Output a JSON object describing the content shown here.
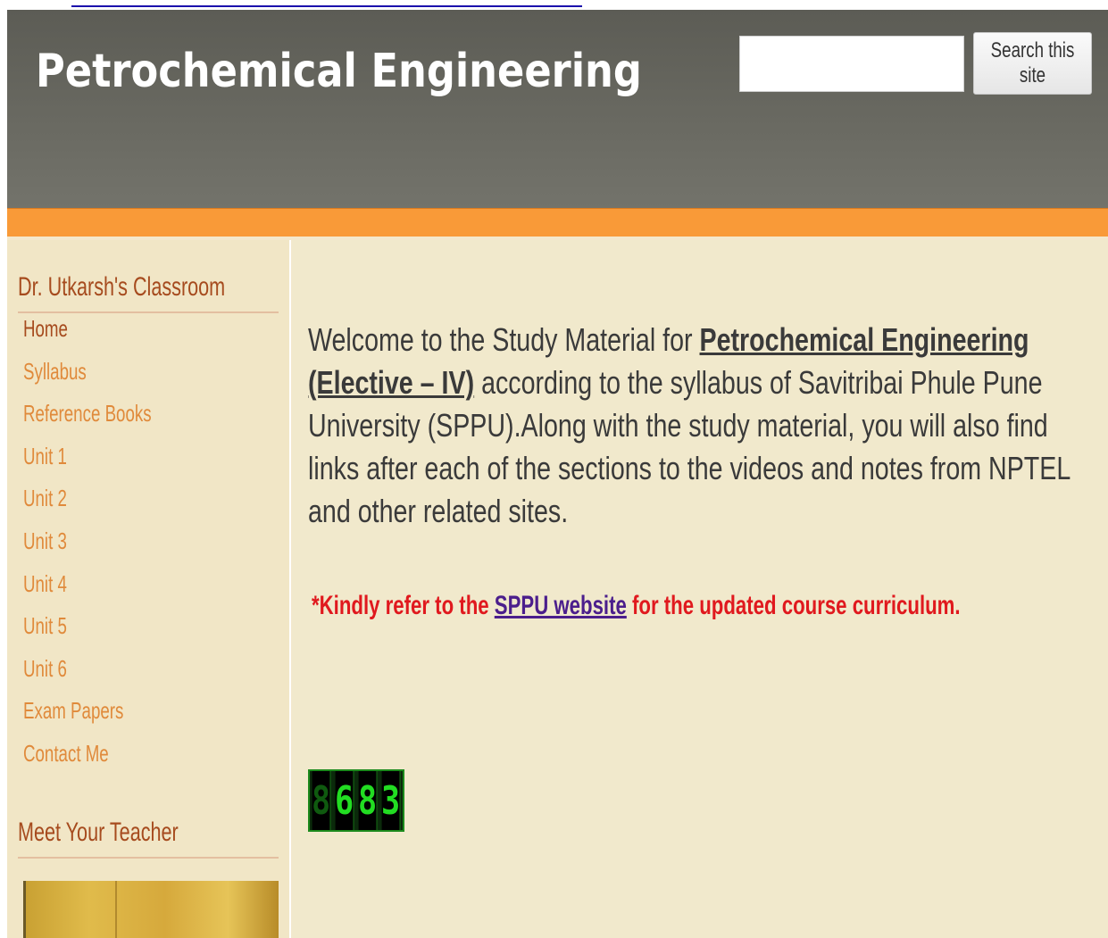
{
  "header": {
    "site_title": "Petrochemical Engineering",
    "search_placeholder": "",
    "search_button_label": "Search this site"
  },
  "sidebar": {
    "classroom_heading": "Dr. Utkarsh's Classroom",
    "items": [
      {
        "label": "Home",
        "active": true
      },
      {
        "label": "Syllabus"
      },
      {
        "label": "Reference Books"
      },
      {
        "label": "Unit 1"
      },
      {
        "label": "Unit 2"
      },
      {
        "label": "Unit 3"
      },
      {
        "label": "Unit 4"
      },
      {
        "label": "Unit 5"
      },
      {
        "label": "Unit 6"
      },
      {
        "label": "Exam Papers"
      },
      {
        "label": "Contact Me"
      }
    ],
    "teacher_heading": "Meet Your Teacher"
  },
  "main": {
    "welcome_prefix": "Welcome to the Study Material for ",
    "course_link": "Petrochemical Engineering (Elective – IV)",
    "welcome_suffix": " according to the syllabus of Savitribai Phule Pune University (SPPU).Along with the study material, you will also find links after each of the sections to the videos and notes from NPTEL and other related sites.",
    "notice_prefix": "*Kindly refer to the ",
    "notice_link": "SPPU website",
    "notice_suffix": " for the updated course curriculum.",
    "visitor_counter": [
      "8",
      "6",
      "8",
      "3"
    ]
  },
  "colors": {
    "header_bg": "#6a6a62",
    "orange_bar": "#f99a38",
    "content_bg": "#f1e9cc",
    "heading": "#a64b1e",
    "nav_link": "#e08a3b",
    "notice": "#e0191e",
    "counter_digit": "#22dd22"
  }
}
